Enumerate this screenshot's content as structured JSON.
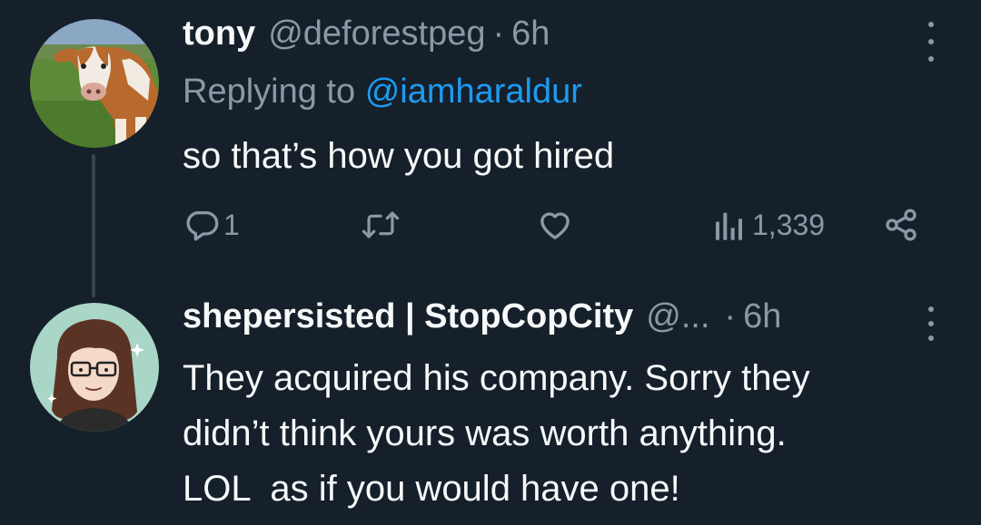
{
  "tweet1": {
    "name": "tony",
    "handle": "@deforestpeg",
    "dot": "·",
    "time": "6h",
    "reply_prefix": "Replying to",
    "reply_handle": "@iamharaldur",
    "text": "so that’s how you got hired",
    "replies": "1",
    "views": "1,339",
    "avatar": "cow-photo"
  },
  "tweet2": {
    "name": "shepersisted | StopCopCity",
    "handle": "@...",
    "dot": "·",
    "time": "6h",
    "text_lines": [
      "They acquired his company. Sorry they",
      "didn’t think yours was worth anything.",
      "LOL  as if you would have one!"
    ],
    "avatar": "illustrated-woman-with-glasses"
  },
  "colors": {
    "background": "#15202b",
    "text": "#f7f9f9",
    "secondary": "#8b98a5",
    "link": "#1d9bf0",
    "thread_line": "#38444d"
  },
  "icons": [
    "more-icon",
    "reply-icon",
    "retweet-icon",
    "like-icon",
    "views-icon",
    "share-icon"
  ]
}
